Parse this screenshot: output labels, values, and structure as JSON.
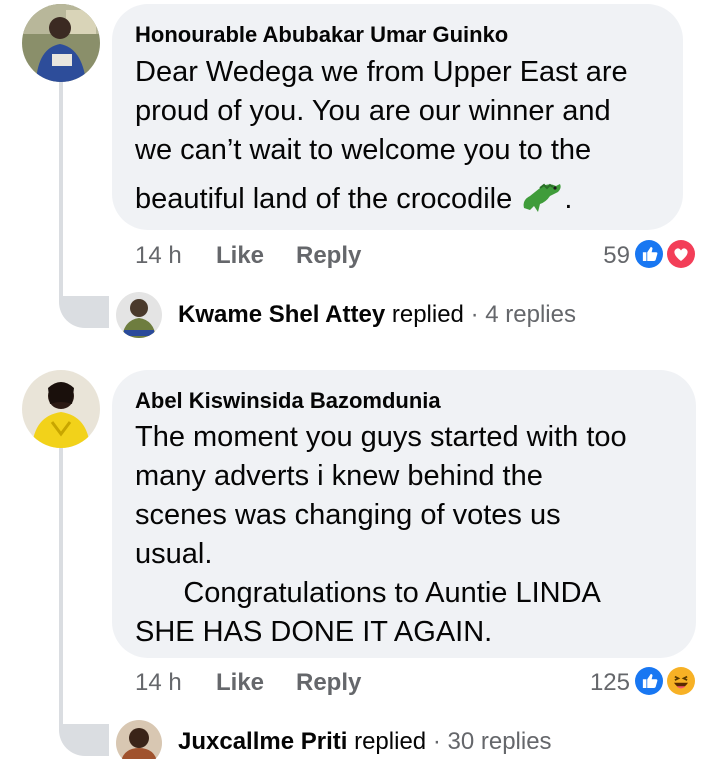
{
  "comments": [
    {
      "author": "Honourable Abubakar Umar Guinko",
      "lines": [
        "Dear Wedega we from Upper East are",
        "proud of you. You are our winner and",
        "we can’t wait to welcome you to the",
        "beautiful land of the crocodile"
      ],
      "trailing_punct": ".",
      "emoji": "crocodile-emoji",
      "time": "14 h",
      "like_label": "Like",
      "reply_label": "Reply",
      "reaction_count": "59",
      "reactions": [
        "like",
        "love"
      ],
      "reply_preview": {
        "name": "Kwame Shel Attey",
        "word": "replied",
        "separator": "·",
        "count": "4 replies"
      }
    },
    {
      "author": "Abel Kiswinsida Bazomdunia",
      "lines": [
        "The moment you guys started with too",
        "many adverts i knew behind the",
        "scenes was changing of votes us",
        "usual.",
        "      Congratulations to Auntie LINDA",
        "SHE HAS DONE IT AGAIN."
      ],
      "time": "14 h",
      "like_label": "Like",
      "reply_label": "Reply",
      "reaction_count": "125",
      "reactions": [
        "like",
        "haha"
      ],
      "reply_preview": {
        "name": "Juxcallme Priti",
        "word": "replied",
        "separator": "·",
        "count": "30 replies"
      }
    }
  ],
  "colors": {
    "bubble": "#f0f2f5",
    "meta_text": "#65676b",
    "like_blue": "#1877f2",
    "love_red": "#f33e58",
    "haha_yellow": "#f7b125",
    "thread_line": "#dadde1"
  }
}
